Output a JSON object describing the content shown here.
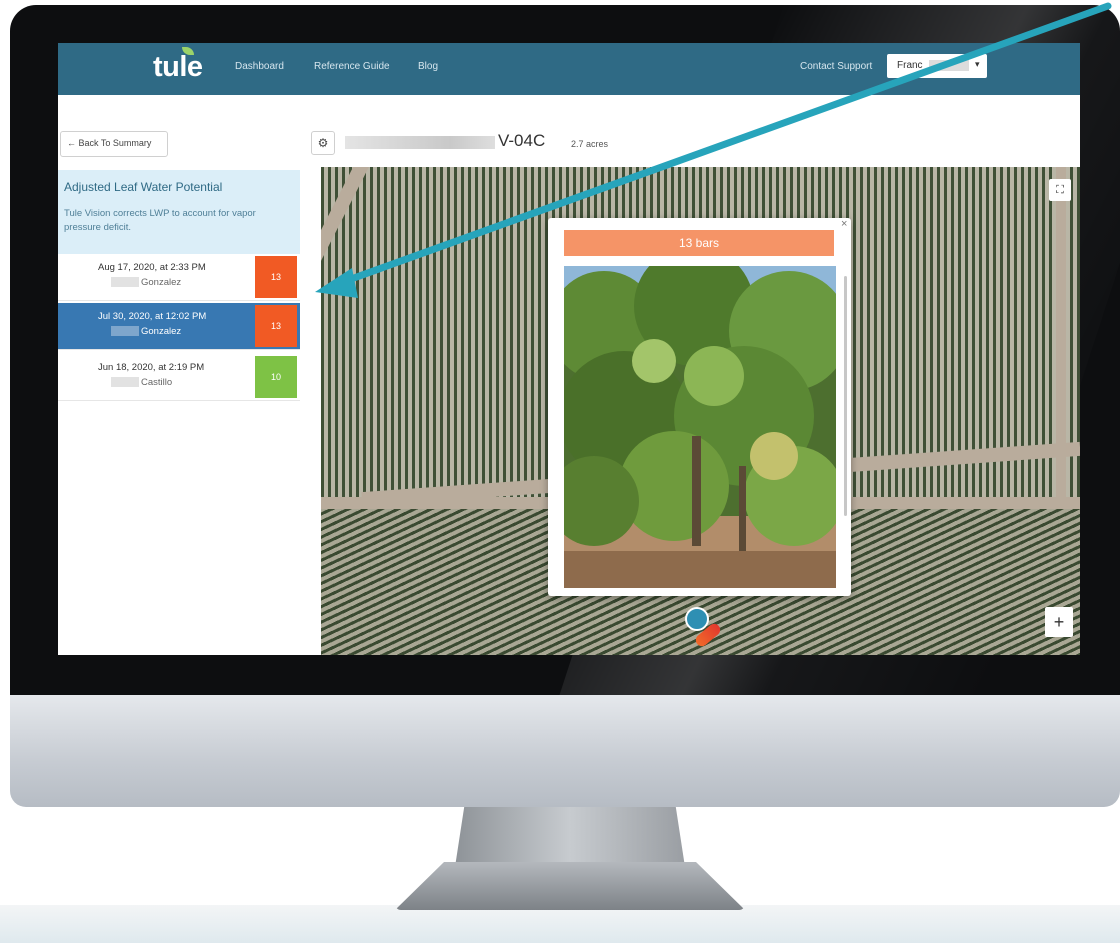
{
  "nav": {
    "logo": "tule",
    "links": [
      "Dashboard",
      "Reference Guide",
      "Blog"
    ],
    "contact": "Contact Support",
    "user": "Franc"
  },
  "sidebar": {
    "back": "← Back To Summary",
    "info_title": "Adjusted Leaf Water Potential",
    "info_text": "Tule Vision corrects LWP to account for vapor pressure deficit.",
    "readings": [
      {
        "date": "Aug 17, 2020, at 2:33 PM",
        "name": "Gonzalez",
        "value": "13",
        "color": "#f15a24"
      },
      {
        "date": "Jul 30, 2020, at 12:02 PM",
        "name": "Gonzalez",
        "value": "13",
        "color": "#f15a24"
      },
      {
        "date": "Jun 18, 2020, at 2:19 PM",
        "name": "Castillo",
        "value": "10",
        "color": "#7ec245"
      }
    ]
  },
  "field": {
    "title": "V-04C",
    "acres": "2.7 acres"
  },
  "popup": {
    "header": "13 bars",
    "close": "×"
  },
  "map": {
    "zoom_in": "+"
  },
  "colors": {
    "nav": "#2f6a85",
    "active_row": "#3878b2",
    "info_bg": "#dbeef8",
    "popup_header": "#f59467",
    "arrow": "#27a4bb"
  }
}
